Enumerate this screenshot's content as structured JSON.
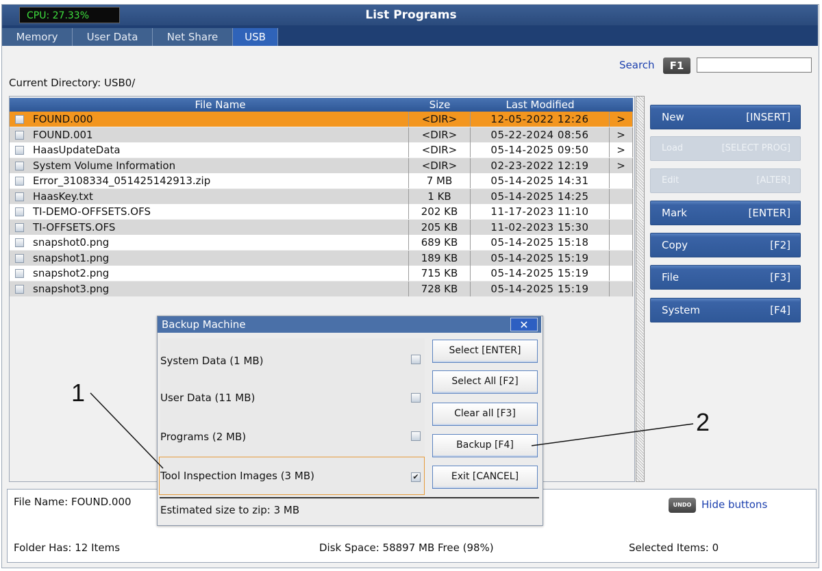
{
  "header": {
    "cpu": "CPU: 27.33%",
    "title": "List Programs"
  },
  "tabs": [
    {
      "label": "Memory"
    },
    {
      "label": "User Data"
    },
    {
      "label": "Net Share"
    },
    {
      "label": "USB"
    }
  ],
  "search": {
    "label": "Search",
    "key": "F1",
    "value": ""
  },
  "current_directory": "Current Directory: USB0/",
  "table": {
    "columns": {
      "name": "File Name",
      "size": "Size",
      "modified": "Last Modified"
    },
    "rows": [
      {
        "name": "FOUND.000",
        "size": "<DIR>",
        "modified": "12-05-2022 12:26",
        "arrow": ">"
      },
      {
        "name": "FOUND.001",
        "size": "<DIR>",
        "modified": "05-22-2024 08:56",
        "arrow": ">"
      },
      {
        "name": "HaasUpdateData",
        "size": "<DIR>",
        "modified": "05-14-2025 09:50",
        "arrow": ">"
      },
      {
        "name": "System Volume Information",
        "size": "<DIR>",
        "modified": "02-23-2022 12:19",
        "arrow": ">"
      },
      {
        "name": "Error_3108334_051425142913.zip",
        "size": "7 MB",
        "modified": "05-14-2025 14:31",
        "arrow": ""
      },
      {
        "name": "HaasKey.txt",
        "size": "1 KB",
        "modified": "05-14-2025 14:25",
        "arrow": ""
      },
      {
        "name": "TI-DEMO-OFFSETS.OFS",
        "size": "202 KB",
        "modified": "11-17-2023 11:10",
        "arrow": ""
      },
      {
        "name": "TI-OFFSETS.OFS",
        "size": "205 KB",
        "modified": "11-02-2023 15:30",
        "arrow": ""
      },
      {
        "name": "snapshot0.png",
        "size": "689 KB",
        "modified": "05-14-2025 15:18",
        "arrow": ""
      },
      {
        "name": "snapshot1.png",
        "size": "189 KB",
        "modified": "05-14-2025 15:19",
        "arrow": ""
      },
      {
        "name": "snapshot2.png",
        "size": "715 KB",
        "modified": "05-14-2025 15:19",
        "arrow": ""
      },
      {
        "name": "snapshot3.png",
        "size": "728 KB",
        "modified": "05-14-2025 15:19",
        "arrow": ""
      }
    ]
  },
  "side_buttons": [
    {
      "label": "New",
      "key": "[INSERT]",
      "enabled": true
    },
    {
      "label": "Load",
      "key": "[SELECT PROG]",
      "enabled": false
    },
    {
      "label": "Edit",
      "key": "[ALTER]",
      "enabled": false
    },
    {
      "label": "Mark",
      "key": "[ENTER]",
      "enabled": true
    },
    {
      "label": "Copy",
      "key": "[F2]",
      "enabled": true
    },
    {
      "label": "File",
      "key": "[F3]",
      "enabled": true
    },
    {
      "label": "System",
      "key": "[F4]",
      "enabled": true
    }
  ],
  "status": {
    "file_name": "File Name: FOUND.000",
    "folder_has": "Folder Has: 12 Items",
    "disk_space": "Disk Space: 58897 MB Free (98%)",
    "selected_items": "Selected Items: 0",
    "undo_key": "UNDO",
    "hide_buttons": "Hide buttons"
  },
  "dialog": {
    "title": "Backup Machine",
    "close": "✕",
    "options": [
      {
        "label": "System Data (1 MB)",
        "checked": false
      },
      {
        "label": "User Data (11 MB)",
        "checked": false
      },
      {
        "label": "Programs (2 MB)",
        "checked": false
      },
      {
        "label": "Tool Inspection Images (3 MB)",
        "checked": true
      }
    ],
    "buttons": [
      "Select [ENTER]",
      "Select All [F2]",
      "Clear all [F3]",
      "Backup [F4]",
      "Exit [CANCEL]"
    ],
    "estimate": "Estimated size to zip: 3 MB"
  },
  "callouts": [
    "1",
    "2"
  ],
  "colors": {
    "title_bar": "#2f5597",
    "selected_row": "#f3961f",
    "link": "#1b3fae",
    "active_tab": "#2f63b9"
  }
}
